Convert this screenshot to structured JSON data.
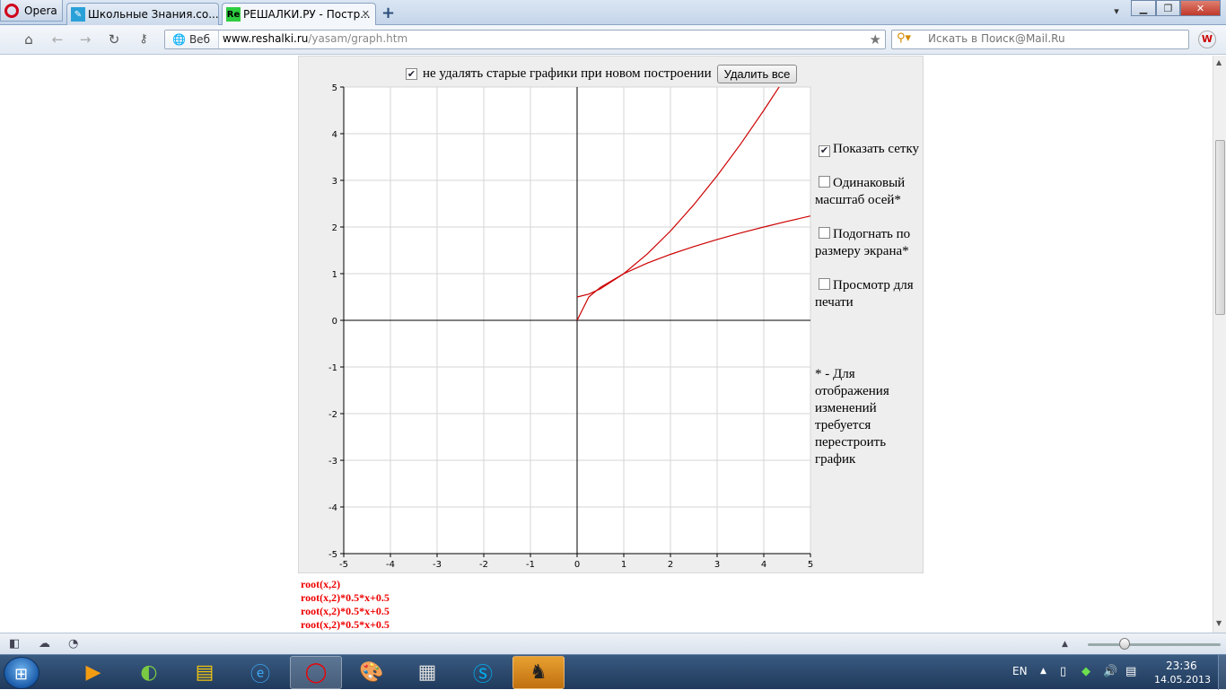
{
  "browser": {
    "menu_label": "Opera",
    "tabs": [
      {
        "title": "Школьные Знания.со...",
        "active": false
      },
      {
        "title": "РЕШАЛКИ.РУ - Постр...",
        "active": true
      }
    ],
    "address": {
      "badge": "Веб",
      "domain": "www.reshalki.ru",
      "path": "/yasam/graph.htm"
    },
    "search": {
      "placeholder": "Искать в Поиск@Mail.Ru"
    }
  },
  "page": {
    "keep_old_label": "не удалять старые графики при новом построении",
    "keep_old_checked": true,
    "clear_button": "Удалить все",
    "options": [
      {
        "label": "Показать сетку",
        "checked": true
      },
      {
        "label": "Одинаковый масштаб осей*",
        "checked": false
      },
      {
        "label": "Подогнать по размеру экрана*",
        "checked": false
      },
      {
        "label": "Просмотр для печати",
        "checked": false
      }
    ],
    "note": "* - Для отображения изменений требуется перестроить график",
    "formulas": [
      "root(x,2)",
      "root(x,2)*0.5*x+0.5",
      "root(x,2)*0.5*x+0.5",
      "root(x,2)*0.5*x+0.5"
    ]
  },
  "chart_data": {
    "type": "line",
    "xlim": [
      -5,
      5
    ],
    "ylim": [
      -5,
      5
    ],
    "x_ticks": [
      "-5",
      "-4",
      "-3",
      "-2",
      "-1",
      "0",
      "1",
      "2",
      "3",
      "4",
      "5"
    ],
    "y_ticks": [
      "5",
      "4",
      "3",
      "2",
      "1",
      "0",
      "-1",
      "-2",
      "-3",
      "-4",
      "-5"
    ],
    "grid": true,
    "series": [
      {
        "formula": "root(x,2)",
        "color": "#cc0000",
        "points": [
          [
            0,
            0
          ],
          [
            0.25,
            0.5
          ],
          [
            0.5,
            0.707
          ],
          [
            1,
            1
          ],
          [
            1.5,
            1.225
          ],
          [
            2,
            1.414
          ],
          [
            2.5,
            1.581
          ],
          [
            3,
            1.732
          ],
          [
            3.5,
            1.871
          ],
          [
            4,
            2
          ],
          [
            4.5,
            2.121
          ],
          [
            5,
            2.236
          ]
        ]
      },
      {
        "formula": "root(x,2)*0.5*x+0.5",
        "color": "#cc0000",
        "points": [
          [
            0,
            0.5
          ],
          [
            0.25,
            0.5625
          ],
          [
            0.5,
            0.677
          ],
          [
            1,
            1
          ],
          [
            1.5,
            1.419
          ],
          [
            2,
            1.914
          ],
          [
            2.5,
            2.476
          ],
          [
            3,
            3.098
          ],
          [
            3.5,
            3.774
          ],
          [
            4,
            4.5
          ],
          [
            4.3,
            4.958
          ],
          [
            4.33,
            5
          ]
        ]
      }
    ]
  },
  "status": {
    "zoom_level": 0.24
  },
  "taskbar": {
    "lang": "EN",
    "time": "23:36",
    "date": "14.05.2013"
  }
}
